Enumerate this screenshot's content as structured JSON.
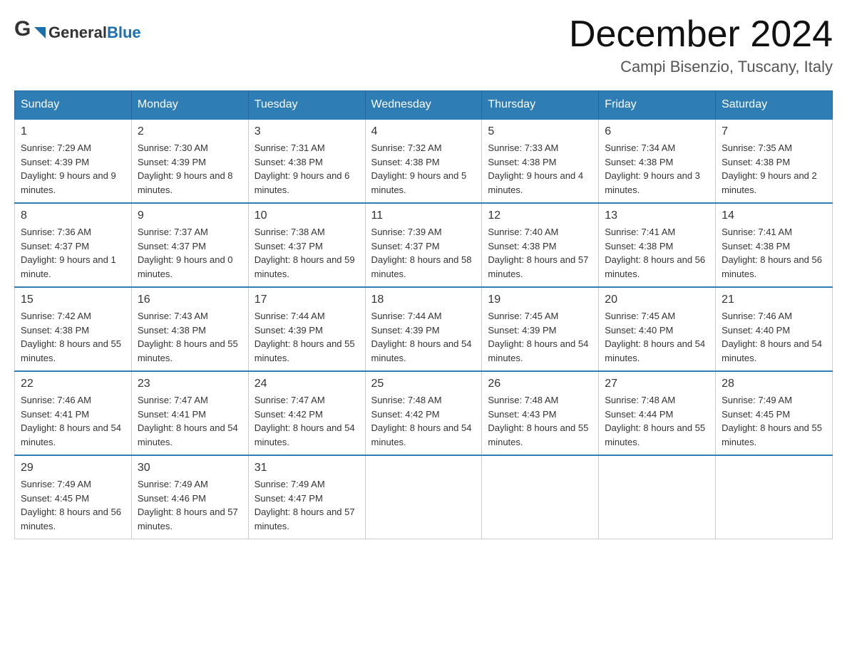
{
  "header": {
    "logo_text_general": "General",
    "logo_text_blue": "Blue",
    "main_title": "December 2024",
    "subtitle": "Campi Bisenzio, Tuscany, Italy"
  },
  "calendar": {
    "days_of_week": [
      "Sunday",
      "Monday",
      "Tuesday",
      "Wednesday",
      "Thursday",
      "Friday",
      "Saturday"
    ],
    "weeks": [
      [
        {
          "day": "1",
          "sunrise": "7:29 AM",
          "sunset": "4:39 PM",
          "daylight": "9 hours and 9 minutes."
        },
        {
          "day": "2",
          "sunrise": "7:30 AM",
          "sunset": "4:39 PM",
          "daylight": "9 hours and 8 minutes."
        },
        {
          "day": "3",
          "sunrise": "7:31 AM",
          "sunset": "4:38 PM",
          "daylight": "9 hours and 6 minutes."
        },
        {
          "day": "4",
          "sunrise": "7:32 AM",
          "sunset": "4:38 PM",
          "daylight": "9 hours and 5 minutes."
        },
        {
          "day": "5",
          "sunrise": "7:33 AM",
          "sunset": "4:38 PM",
          "daylight": "9 hours and 4 minutes."
        },
        {
          "day": "6",
          "sunrise": "7:34 AM",
          "sunset": "4:38 PM",
          "daylight": "9 hours and 3 minutes."
        },
        {
          "day": "7",
          "sunrise": "7:35 AM",
          "sunset": "4:38 PM",
          "daylight": "9 hours and 2 minutes."
        }
      ],
      [
        {
          "day": "8",
          "sunrise": "7:36 AM",
          "sunset": "4:37 PM",
          "daylight": "9 hours and 1 minute."
        },
        {
          "day": "9",
          "sunrise": "7:37 AM",
          "sunset": "4:37 PM",
          "daylight": "9 hours and 0 minutes."
        },
        {
          "day": "10",
          "sunrise": "7:38 AM",
          "sunset": "4:37 PM",
          "daylight": "8 hours and 59 minutes."
        },
        {
          "day": "11",
          "sunrise": "7:39 AM",
          "sunset": "4:37 PM",
          "daylight": "8 hours and 58 minutes."
        },
        {
          "day": "12",
          "sunrise": "7:40 AM",
          "sunset": "4:38 PM",
          "daylight": "8 hours and 57 minutes."
        },
        {
          "day": "13",
          "sunrise": "7:41 AM",
          "sunset": "4:38 PM",
          "daylight": "8 hours and 56 minutes."
        },
        {
          "day": "14",
          "sunrise": "7:41 AM",
          "sunset": "4:38 PM",
          "daylight": "8 hours and 56 minutes."
        }
      ],
      [
        {
          "day": "15",
          "sunrise": "7:42 AM",
          "sunset": "4:38 PM",
          "daylight": "8 hours and 55 minutes."
        },
        {
          "day": "16",
          "sunrise": "7:43 AM",
          "sunset": "4:38 PM",
          "daylight": "8 hours and 55 minutes."
        },
        {
          "day": "17",
          "sunrise": "7:44 AM",
          "sunset": "4:39 PM",
          "daylight": "8 hours and 55 minutes."
        },
        {
          "day": "18",
          "sunrise": "7:44 AM",
          "sunset": "4:39 PM",
          "daylight": "8 hours and 54 minutes."
        },
        {
          "day": "19",
          "sunrise": "7:45 AM",
          "sunset": "4:39 PM",
          "daylight": "8 hours and 54 minutes."
        },
        {
          "day": "20",
          "sunrise": "7:45 AM",
          "sunset": "4:40 PM",
          "daylight": "8 hours and 54 minutes."
        },
        {
          "day": "21",
          "sunrise": "7:46 AM",
          "sunset": "4:40 PM",
          "daylight": "8 hours and 54 minutes."
        }
      ],
      [
        {
          "day": "22",
          "sunrise": "7:46 AM",
          "sunset": "4:41 PM",
          "daylight": "8 hours and 54 minutes."
        },
        {
          "day": "23",
          "sunrise": "7:47 AM",
          "sunset": "4:41 PM",
          "daylight": "8 hours and 54 minutes."
        },
        {
          "day": "24",
          "sunrise": "7:47 AM",
          "sunset": "4:42 PM",
          "daylight": "8 hours and 54 minutes."
        },
        {
          "day": "25",
          "sunrise": "7:48 AM",
          "sunset": "4:42 PM",
          "daylight": "8 hours and 54 minutes."
        },
        {
          "day": "26",
          "sunrise": "7:48 AM",
          "sunset": "4:43 PM",
          "daylight": "8 hours and 55 minutes."
        },
        {
          "day": "27",
          "sunrise": "7:48 AM",
          "sunset": "4:44 PM",
          "daylight": "8 hours and 55 minutes."
        },
        {
          "day": "28",
          "sunrise": "7:49 AM",
          "sunset": "4:45 PM",
          "daylight": "8 hours and 55 minutes."
        }
      ],
      [
        {
          "day": "29",
          "sunrise": "7:49 AM",
          "sunset": "4:45 PM",
          "daylight": "8 hours and 56 minutes."
        },
        {
          "day": "30",
          "sunrise": "7:49 AM",
          "sunset": "4:46 PM",
          "daylight": "8 hours and 57 minutes."
        },
        {
          "day": "31",
          "sunrise": "7:49 AM",
          "sunset": "4:47 PM",
          "daylight": "8 hours and 57 minutes."
        },
        null,
        null,
        null,
        null
      ]
    ]
  }
}
